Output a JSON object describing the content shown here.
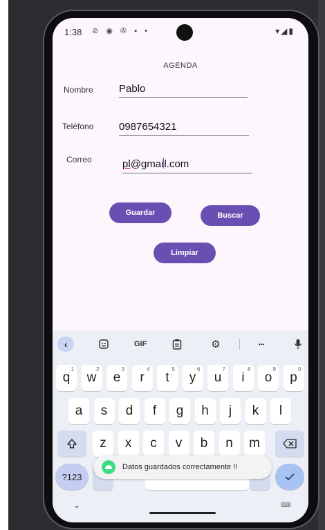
{
  "status_bar": {
    "time": "1:38",
    "notification_icons": "⊘ ◉ ✇ ▪ •",
    "right_icons": "▾◢▮"
  },
  "app": {
    "title": "AGENDA",
    "fields": [
      {
        "label": "Nombre",
        "value": "Pablo"
      },
      {
        "label": "Teléfono",
        "value": "0987654321"
      },
      {
        "label": "Correo",
        "value_prefix": "pl",
        "value_mid": "@gmai",
        "value_suffix": "l.com"
      }
    ],
    "buttons": {
      "save": "Guardar",
      "search": "Buscar",
      "clear": "Limpiar"
    }
  },
  "keyboard": {
    "toolbar": {
      "gif": "GIF",
      "more": "•••"
    },
    "row1": [
      "q",
      "w",
      "e",
      "r",
      "t",
      "y",
      "u",
      "i",
      "o",
      "p"
    ],
    "row1_hints": [
      "1",
      "2",
      "3",
      "4",
      "5",
      "6",
      "7",
      "8",
      "9",
      "0"
    ],
    "row2": [
      "a",
      "s",
      "d",
      "f",
      "g",
      "h",
      "j",
      "k",
      "l"
    ],
    "row3": [
      "z",
      "x",
      "c",
      "v",
      "b",
      "n",
      "m"
    ],
    "symbols_key": "?123"
  },
  "toast": {
    "message": "Datos guardados correctamente !!"
  },
  "colors": {
    "accent": "#6a4fb3",
    "screen_bg": "#fdf7fd",
    "keyboard_bg": "#eceff6"
  }
}
